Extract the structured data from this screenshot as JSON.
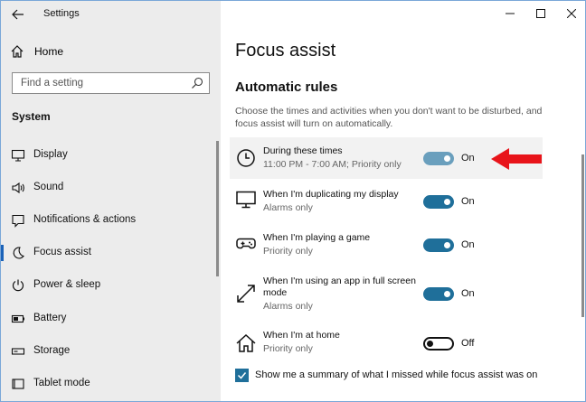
{
  "app_title": "Settings",
  "home_label": "Home",
  "search": {
    "placeholder": "Find a setting"
  },
  "section_title": "System",
  "nav": [
    {
      "label": "Display",
      "icon": "monitor-icon"
    },
    {
      "label": "Sound",
      "icon": "speaker-icon"
    },
    {
      "label": "Notifications & actions",
      "icon": "notifications-icon"
    },
    {
      "label": "Focus assist",
      "icon": "moon-icon",
      "active": true
    },
    {
      "label": "Power & sleep",
      "icon": "power-icon"
    },
    {
      "label": "Battery",
      "icon": "battery-icon"
    },
    {
      "label": "Storage",
      "icon": "storage-icon"
    },
    {
      "label": "Tablet mode",
      "icon": "tablet-icon"
    }
  ],
  "page": {
    "title": "Focus assist",
    "subtitle": "Automatic rules",
    "description": "Choose the times and activities when you don't want to be disturbed, and focus assist will turn on automatically."
  },
  "rules": [
    {
      "name": "During these times",
      "detail": "11:00 PM - 7:00 AM; Priority only",
      "state": "On",
      "on": true,
      "icon": "clock-icon"
    },
    {
      "name": "When I'm duplicating my display",
      "detail": "Alarms only",
      "state": "On",
      "on": true,
      "icon": "monitor-icon"
    },
    {
      "name": "When I'm playing a game",
      "detail": "Priority only",
      "state": "On",
      "on": true,
      "icon": "gamepad-icon"
    },
    {
      "name": "When I'm using an app in full screen mode",
      "detail": "Alarms only",
      "state": "On",
      "on": true,
      "icon": "fullscreen-icon"
    },
    {
      "name": "When I'm at home",
      "detail": "Priority only",
      "state": "Off",
      "on": false,
      "icon": "home-icon"
    }
  ],
  "summary_checkbox": {
    "label": "Show me a summary of what I missed while focus assist was on",
    "checked": true
  },
  "colors": {
    "accent": "#1f6f9a",
    "arrow": "#e8141a",
    "sidebar_bg": "#ececec"
  }
}
